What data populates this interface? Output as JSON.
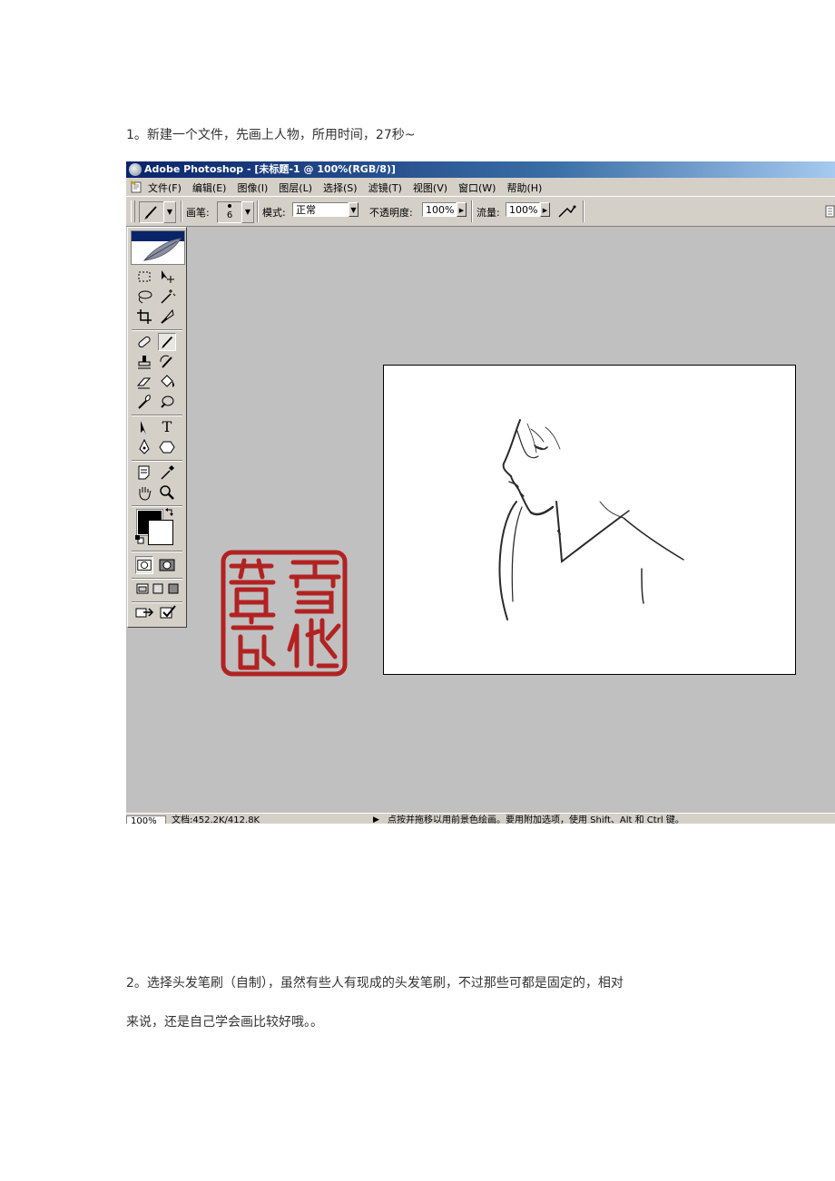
{
  "article": {
    "step1": "1。新建一个文件，先画上人物，所用时间，27秒~",
    "step2_line1": "2。选择头发笔刷（自制），虽然有些人有现成的头发笔刷，不过那些可都是固定的，相对",
    "step2_line2": "来说，还是自己学会画比较好哦。。"
  },
  "window": {
    "title": "Adobe Photoshop - [未标题-1 @ 100%(RGB/8)]"
  },
  "menu": {
    "items": [
      "文件(F)",
      "编辑(E)",
      "图像(I)",
      "图层(L)",
      "选择(S)",
      "滤镜(T)",
      "视图(V)",
      "窗口(W)",
      "帮助(H)"
    ]
  },
  "options": {
    "brush_label": "画笔:",
    "brush_size": "6",
    "mode_label": "模式:",
    "mode_value": "正常",
    "opacity_label": "不透明度:",
    "opacity_value": "100%",
    "flow_label": "流量:",
    "flow_value": "100%"
  },
  "toolbox": {
    "tools": [
      "rectangular-marquee",
      "move",
      "lasso",
      "magic-wand",
      "crop",
      "slice",
      "healing-brush",
      "brush",
      "clone-stamp",
      "history-brush",
      "eraser",
      "paint-bucket",
      "blur",
      "dodge",
      "path-selection",
      "type",
      "pen",
      "shape",
      "notes",
      "eyedropper",
      "hand",
      "zoom"
    ],
    "type_glyph": "T"
  },
  "stamp": {
    "text": "雪花笔印",
    "color": "#b22222"
  },
  "status": {
    "zoom": "100%",
    "doc": "文档:452.2K/412.8K",
    "hint": "点按并拖移以用前景色绘画。要用附加选项，使用 Shift、Alt 和 Ctrl 键。"
  },
  "colors": {
    "title_bar": "#0a246a",
    "chrome": "#d4d0c8",
    "workspace": "#c0c0c0",
    "foreground": "#000000",
    "background": "#ffffff"
  }
}
